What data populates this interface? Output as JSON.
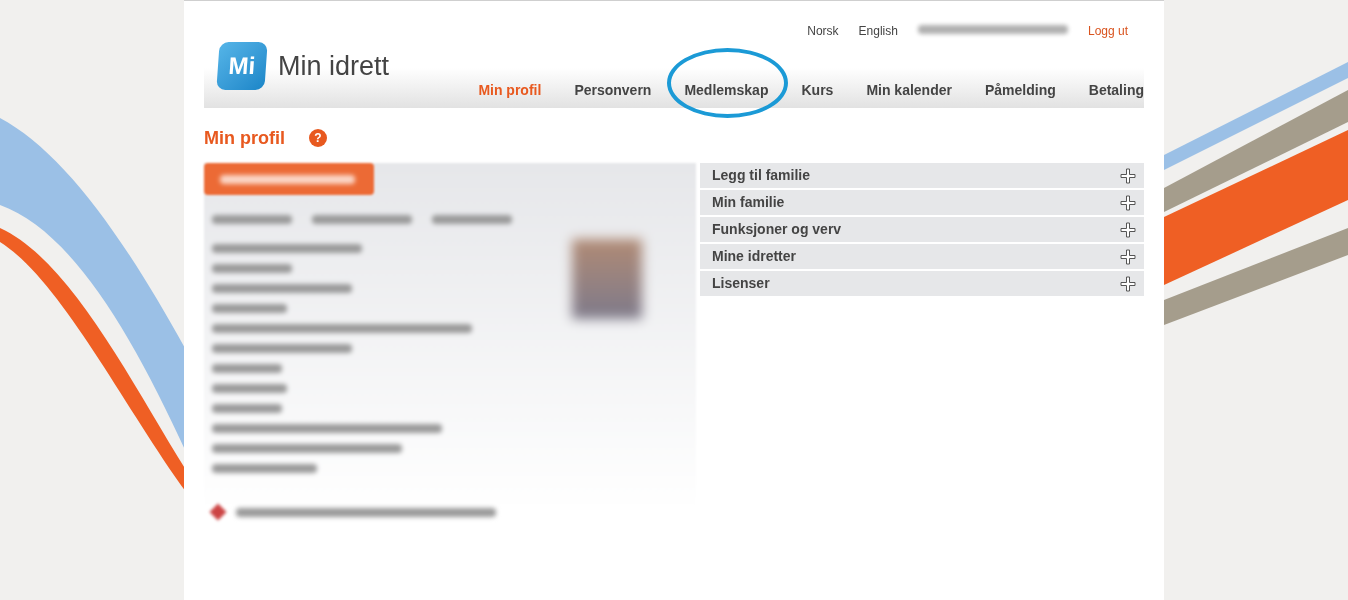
{
  "top_links": [
    {
      "label": "Norsk",
      "kind": "plain"
    },
    {
      "label": "English",
      "kind": "plain"
    },
    {
      "kind": "blurred"
    },
    {
      "label": "Logg ut",
      "kind": "accent"
    }
  ],
  "logo": {
    "mark": "Mi",
    "name": "Min idrett"
  },
  "nav": [
    {
      "label": "Min profil",
      "selected": true,
      "circled": false
    },
    {
      "label": "Personvern",
      "selected": false,
      "circled": false
    },
    {
      "label": "Medlemskap",
      "selected": false,
      "circled": true
    },
    {
      "label": "Kurs",
      "selected": false,
      "circled": false
    },
    {
      "label": "Min kalender",
      "selected": false,
      "circled": false
    },
    {
      "label": "Påmelding",
      "selected": false,
      "circled": false
    },
    {
      "label": "Betaling",
      "selected": false,
      "circled": false
    }
  ],
  "page_title": "Min profil",
  "help_icon": "?",
  "sections": [
    {
      "label": "Legg til familie",
      "expanded": false
    },
    {
      "label": "Min familie",
      "expanded": false
    },
    {
      "label": "Funksjoner og verv",
      "expanded": false
    },
    {
      "label": "Mine idretter",
      "expanded": false
    },
    {
      "label": "Lisenser",
      "expanded": false
    }
  ]
}
